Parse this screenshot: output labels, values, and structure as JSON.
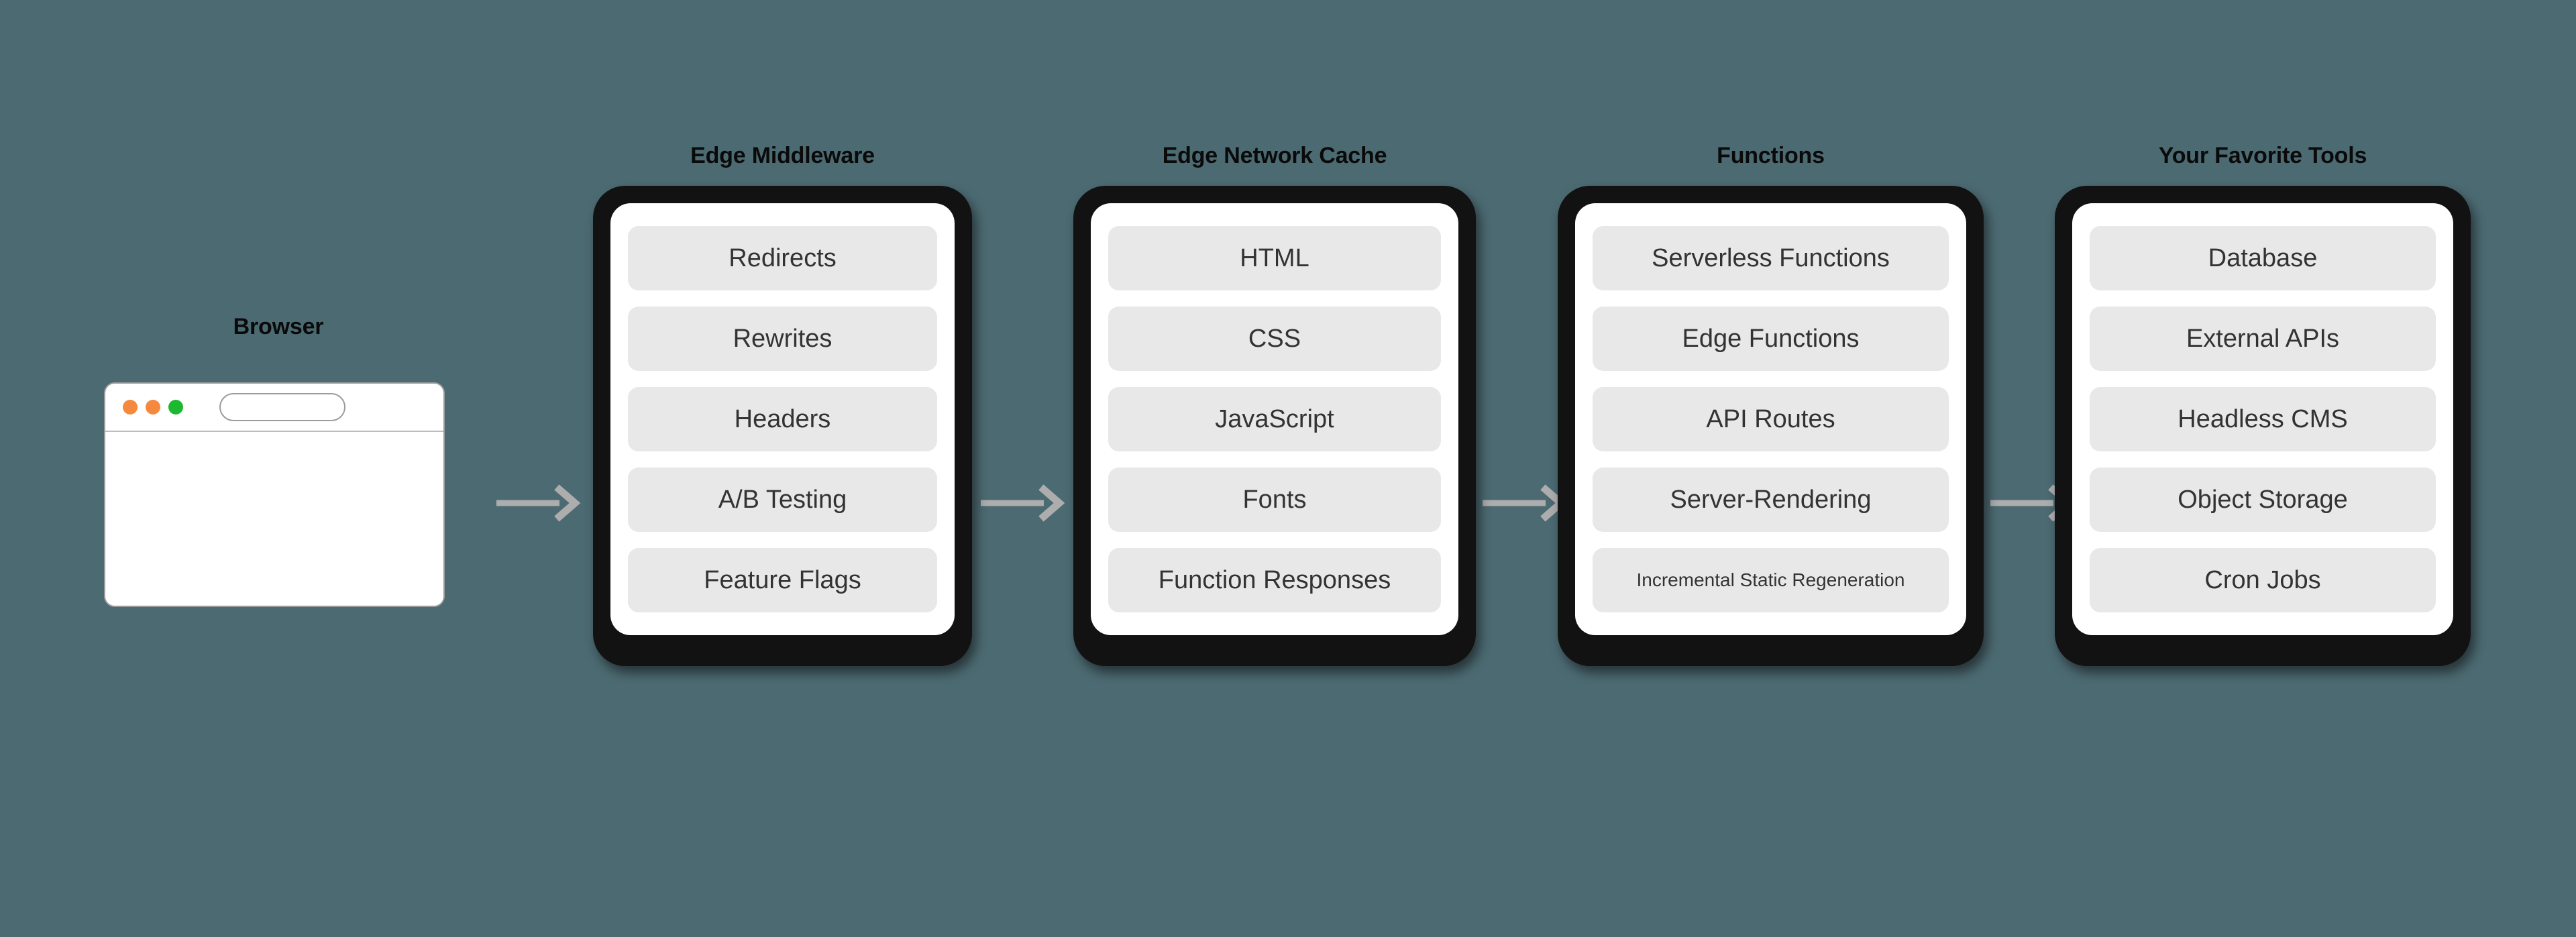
{
  "theme": {
    "background": "#4c6a72",
    "card_border": "#121212",
    "card_surface": "#ffffff",
    "pill_surface": "#e8e8e8",
    "pill_text": "#333333",
    "title_text": "#0a0a0a",
    "arrow": "#adadad"
  },
  "browser": {
    "title": "Browser",
    "url_value": "",
    "url_placeholder": "",
    "traffic_lights": [
      {
        "name": "close-dot",
        "color": "#f5893d"
      },
      {
        "name": "minimize-dot",
        "color": "#f5893d"
      },
      {
        "name": "maximize-dot",
        "color": "#1cb82f"
      }
    ]
  },
  "arrows": [
    {
      "name": "arrow-browser-to-edge-middleware",
      "glyph": "arrow-right-icon"
    },
    {
      "name": "arrow-edge-middleware-to-edge-network-cache",
      "glyph": "arrow-right-icon"
    },
    {
      "name": "arrow-edge-network-cache-to-functions",
      "glyph": "arrow-right-icon"
    },
    {
      "name": "arrow-functions-to-your-favorite-tools",
      "glyph": "arrow-right-icon"
    }
  ],
  "columns": [
    {
      "title": "Edge Middleware",
      "items": [
        {
          "label": "Redirects",
          "wrap": false
        },
        {
          "label": "Rewrites",
          "wrap": false
        },
        {
          "label": "Headers",
          "wrap": false
        },
        {
          "label": "A/B Testing",
          "wrap": false
        },
        {
          "label": "Feature Flags",
          "wrap": false
        }
      ]
    },
    {
      "title": "Edge Network Cache",
      "items": [
        {
          "label": "HTML",
          "wrap": false
        },
        {
          "label": "CSS",
          "wrap": false
        },
        {
          "label": "JavaScript",
          "wrap": false
        },
        {
          "label": "Fonts",
          "wrap": false
        },
        {
          "label": "Function Responses",
          "wrap": false
        }
      ]
    },
    {
      "title": "Functions",
      "items": [
        {
          "label": "Serverless Functions",
          "wrap": false
        },
        {
          "label": "Edge Functions",
          "wrap": false
        },
        {
          "label": "API Routes",
          "wrap": false
        },
        {
          "label": "Server-Rendering",
          "wrap": false
        },
        {
          "label": "Incremental Static Regeneration",
          "wrap": true
        }
      ]
    },
    {
      "title": "Your Favorite Tools",
      "items": [
        {
          "label": "Database",
          "wrap": false
        },
        {
          "label": "External APIs",
          "wrap": false
        },
        {
          "label": "Headless CMS",
          "wrap": false
        },
        {
          "label": "Object Storage",
          "wrap": false
        },
        {
          "label": "Cron Jobs",
          "wrap": false
        }
      ]
    }
  ]
}
